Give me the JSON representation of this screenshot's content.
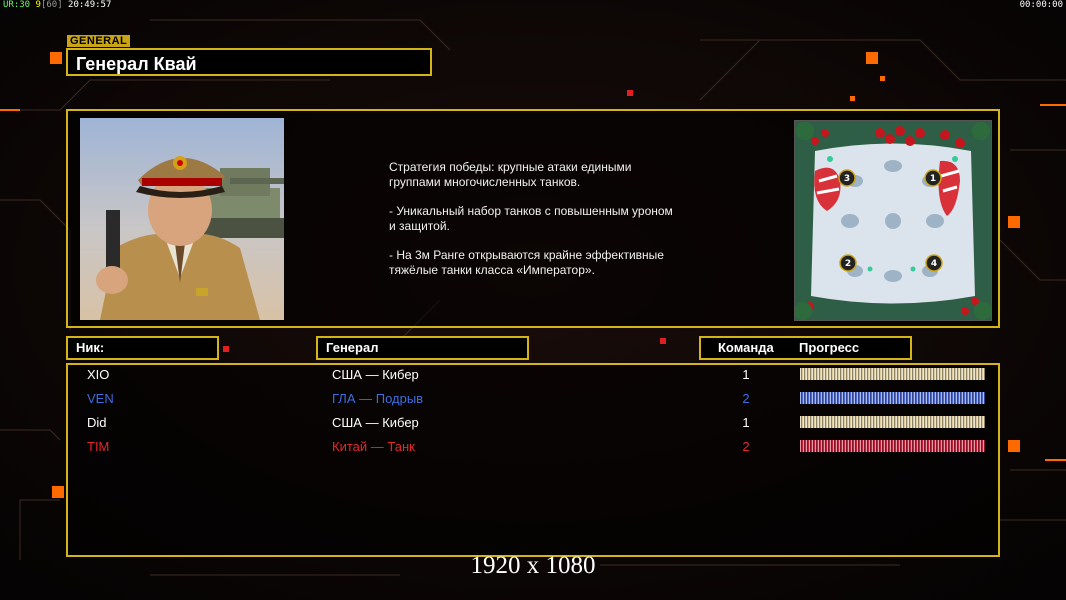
{
  "hud": {
    "stats_prefix": "UR:30",
    "stats_mid": "9",
    "stats_fps": "[60]",
    "time": "20:49:57",
    "clock_right": "00:00:00"
  },
  "general": {
    "tag": "GENERAL",
    "name": "Генерал Квай",
    "description": [
      "Стратегия победы: крупные атаки едиными\n группами многочисленных танков.",
      "- Уникальный набор танков с повышенным уроном\n и защитой.",
      "- На 3м Ранге открываются крайне эффективные\n тяжёлые танки класса «Император»."
    ],
    "portrait_icon": "general-portrait",
    "minimap_icon": "winter-minimap",
    "minimap_slots": [
      "3",
      "1",
      "2",
      "4"
    ]
  },
  "columns": {
    "nick": "Ник:",
    "general": "Генерал",
    "team": "Команда",
    "progress": "Прогресс"
  },
  "players": [
    {
      "nick": "XIO",
      "general": "США — Кибер",
      "team": "1",
      "color": "#ffffff",
      "bar": "#d8c89a"
    },
    {
      "nick": "VEN",
      "general": "ГЛА — Подрыв",
      "team": "2",
      "color": "#3e6de0",
      "bar": "#4a68d8"
    },
    {
      "nick": "Did",
      "general": "США — Кибер",
      "team": "1",
      "color": "#ffffff",
      "bar": "#d8c89a"
    },
    {
      "nick": "TIM",
      "general": "Китай — Танк",
      "team": "2",
      "color": "#e22a2a",
      "bar": "#c8203a"
    }
  ],
  "colors": {
    "frame": "#d4b417",
    "accent_orange": "#ff6a00",
    "background": "#0b0707"
  },
  "resolution_label": "1920 x 1080"
}
